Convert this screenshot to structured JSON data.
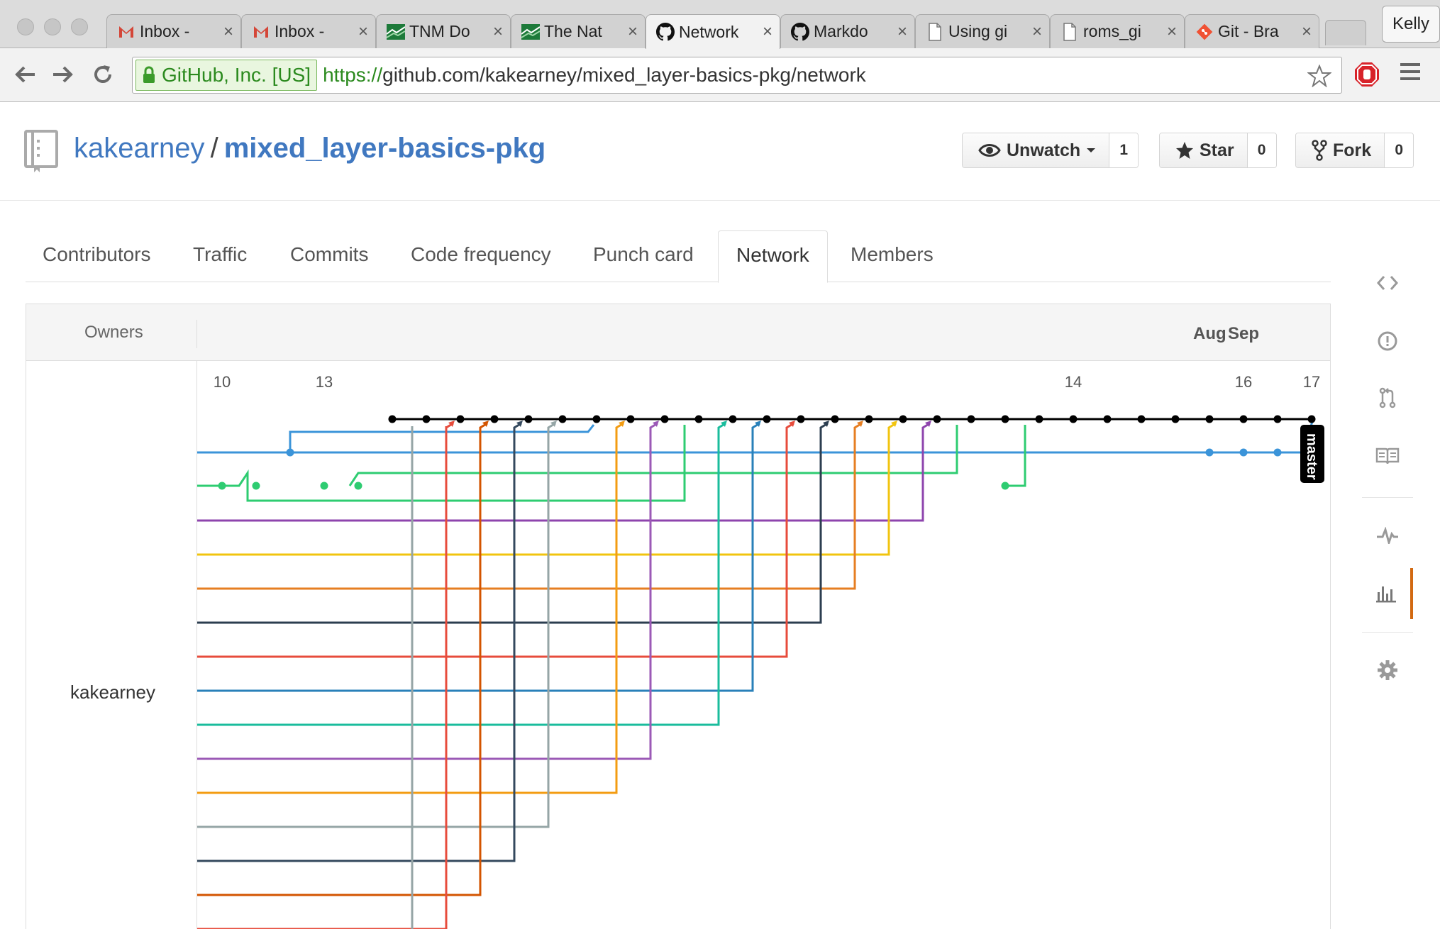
{
  "browser": {
    "tabs": [
      {
        "title": "Inbox - ",
        "icon": "gmail-icon"
      },
      {
        "title": "Inbox - ",
        "icon": "gmail-icon"
      },
      {
        "title": "TNM Do",
        "icon": "tnm-icon"
      },
      {
        "title": "The Nat",
        "icon": "tnm-icon"
      },
      {
        "title": "Network",
        "icon": "github-icon",
        "active": true
      },
      {
        "title": "Markdo",
        "icon": "github-icon"
      },
      {
        "title": "Using gi",
        "icon": "page-icon"
      },
      {
        "title": "roms_gi",
        "icon": "page-icon"
      },
      {
        "title": "Git - Bra",
        "icon": "git-icon"
      }
    ],
    "close_glyph": "×",
    "profile_name": "Kelly",
    "ev_label": "GitHub, Inc. [US]",
    "url_scheme": "https://",
    "url_rest": "github.com/kakearney/mixed_layer-basics-pkg/network"
  },
  "repo": {
    "owner": "kakearney",
    "separator": "/",
    "name": "mixed_layer-basics-pkg",
    "unwatch_label": "Unwatch",
    "unwatch_count": "1",
    "star_label": "Star",
    "star_count": "0",
    "fork_label": "Fork",
    "fork_count": "0"
  },
  "graph_tabs": [
    "Contributors",
    "Traffic",
    "Commits",
    "Code frequency",
    "Punch card",
    "Network",
    "Members"
  ],
  "network": {
    "owners_label": "Owners",
    "owner": "kakearney",
    "months": [
      "Aug",
      "Sep"
    ],
    "day_labels": [
      "10",
      "13",
      "14",
      "16",
      "17"
    ],
    "branch_label": "master"
  },
  "colors": {
    "link": "#4078c0",
    "active_accent": "#d26911",
    "branch_colors": [
      "#3b94d9",
      "#2ecc71",
      "#8e44ad",
      "#f1c40f",
      "#e67e22",
      "#2c3e50",
      "#e74c3c",
      "#2980b9",
      "#1abc9c",
      "#9b59b6",
      "#f39c12",
      "#95a5a6",
      "#34495e",
      "#d35400",
      "#e74c3c"
    ]
  }
}
